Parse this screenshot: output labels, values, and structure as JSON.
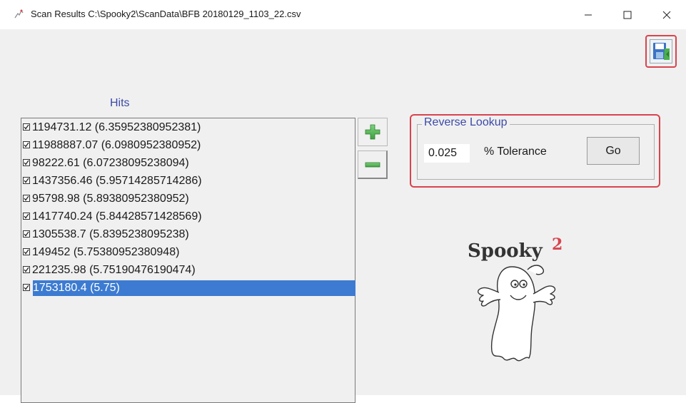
{
  "window": {
    "title": "Scan Results C:\\Spooky2\\ScanData\\BFB 20180129_1103_22.csv",
    "icon": "spooky-app-icon"
  },
  "window_controls": [
    "minimize-icon",
    "maximize-icon",
    "close-icon"
  ],
  "toolbar": {
    "save_icon": "save-icon"
  },
  "hits": {
    "label": "Hits",
    "items": [
      {
        "text": "1194731.12  (6.35952380952381)",
        "checked": true,
        "selected": false
      },
      {
        "text": "11988887.07  (6.0980952380952)",
        "checked": true,
        "selected": false
      },
      {
        "text": "98222.61  (6.07238095238094)",
        "checked": true,
        "selected": false
      },
      {
        "text": "1437356.46  (5.95714285714286)",
        "checked": true,
        "selected": false
      },
      {
        "text": "95798.98  (5.89380952380952)",
        "checked": true,
        "selected": false
      },
      {
        "text": "1417740.24  (5.84428571428569)",
        "checked": true,
        "selected": false
      },
      {
        "text": "1305538.7  (5.8395238095238)",
        "checked": true,
        "selected": false
      },
      {
        "text": "149452  (5.75380952380948)",
        "checked": true,
        "selected": false
      },
      {
        "text": "221235.98  (5.75190476190474)",
        "checked": true,
        "selected": false
      },
      {
        "text": "1753180.4  (5.75)",
        "checked": true,
        "selected": true
      }
    ]
  },
  "side_buttons": {
    "add_icon": "plus-icon",
    "remove_icon": "minus-icon"
  },
  "reverse_lookup": {
    "legend": "Reverse Lookup",
    "tolerance_value": "0.025",
    "tolerance_label": "% Tolerance",
    "go_label": "Go"
  },
  "logo": {
    "text": "Spooky",
    "superscript": "2"
  },
  "colors": {
    "accent_red": "#d9434e",
    "label_blue": "#3b4aa8",
    "selection_blue": "#3c7bd1",
    "green_button": "#4bb04b"
  }
}
